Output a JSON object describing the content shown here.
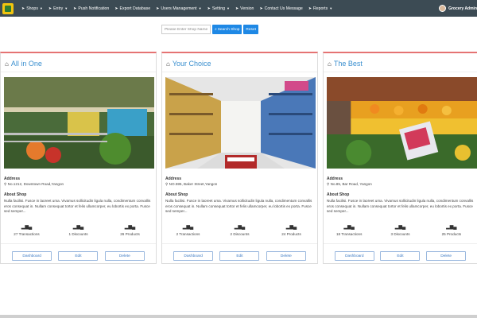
{
  "topnav": {
    "items": [
      {
        "label": "Shops",
        "caret": true
      },
      {
        "label": "Entry",
        "caret": true
      },
      {
        "label": "Push Notification",
        "caret": false
      },
      {
        "label": "Export Database",
        "caret": false
      },
      {
        "label": "Users Management",
        "caret": true
      },
      {
        "label": "Setting",
        "caret": true
      },
      {
        "label": "Version",
        "caret": false
      },
      {
        "label": "Contact Us Message",
        "caret": false
      },
      {
        "label": "Reports",
        "caret": true
      }
    ],
    "user": "Grocery Admin"
  },
  "search": {
    "placeholder": "Please Enter Shop Name",
    "search_label": "Search Shop",
    "reset_label": "Reset"
  },
  "labels": {
    "address": "Address",
    "about": "About Shop",
    "dashboard": "Dashboard",
    "edit": "Edit",
    "delete": "Delete"
  },
  "shops": [
    {
      "name": "All in One",
      "address": "No.1212, Downtown Road,Yangon",
      "about": "Nulla facilisi. Fusce in laoreet uma. Vivamus sollicitudin ligula nulla, condimentum convallis eros consequat in. Nullam consequat tortor et felis ullamcorper, eu lobortis ex porta. Fusce sed semper...",
      "transactions": "27 Transactions",
      "discounts": "1 Discounts",
      "products": "26 Products"
    },
    {
      "name": "Your Choice",
      "address": "NO.595, Baker Street,Yangon",
      "about": "Nulla facilisi. Fusce in laoreet uma. Vivamus sollicitudin ligula nulla, condimentum convallis eros consequat in. Nullam consequat tortor et felis ullamcorper, eu lobortis ex porta. Fusce sed semper...",
      "transactions": "2 Transactions",
      "discounts": "2 Discounts",
      "products": "24 Products"
    },
    {
      "name": "The Best",
      "address": "No.85, Bar Road, Yangon",
      "about": "Nulla facilisi. Fusce in laoreet uma. Vivamus sollicitudin ligula nulla, condimentum convallis eros consequat in. Nullam consequat tortor et felis ullamcorper, eu lobortis ex porta. Fusce sed semper...",
      "transactions": "18 Transactions",
      "discounts": "3 Discounts",
      "products": "25 Products"
    }
  ]
}
